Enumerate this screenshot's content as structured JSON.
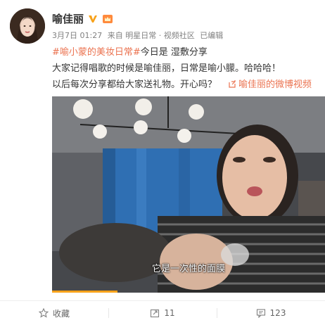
{
  "post": {
    "author": "喻佳丽",
    "meta": {
      "date": "3月7日 01:27",
      "source": "来自 明星日常 · 视频社区",
      "status": "已编辑"
    },
    "lines": {
      "line1_topic": "#喻小蒙的美妆日常#",
      "line1_rest": "今日是 湿敷分享",
      "line2": "大家记得唱歌的时候是喻佳丽，日常是喻小朦。哈哈哈！",
      "line3": "以后每次分享都给大家送礼物。开心吗？",
      "video_link": "喻佳丽的微博视频"
    },
    "video": {
      "subtitle": "它是一次性的面膜",
      "progress": 0.24
    }
  },
  "actions": {
    "favorite_label": "收藏",
    "repost_count": "11",
    "comment_count": "123"
  },
  "colors": {
    "accent": "#eb7350",
    "vip": "#f7a21b",
    "progress": "#f7a21b"
  },
  "icons": [
    "vip-icon",
    "crown-icon",
    "link-icon",
    "star-icon",
    "repost-icon",
    "comment-icon"
  ]
}
